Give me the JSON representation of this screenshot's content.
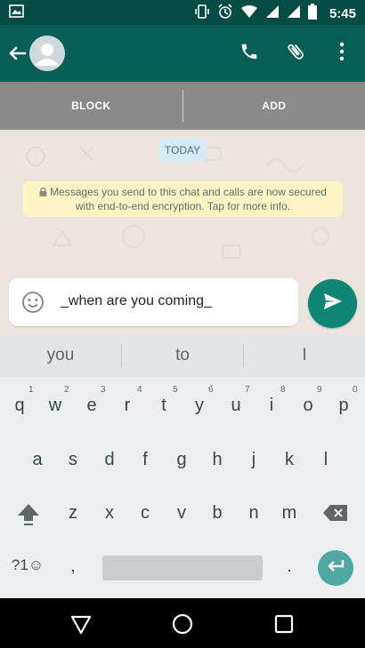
{
  "status_bar": {
    "time": "5:45"
  },
  "app_bar": {
    "icons": [
      "back-icon",
      "avatar",
      "phone-icon",
      "paperclip-icon",
      "more-vert-icon"
    ]
  },
  "actions_bar": {
    "block_label": "BLOCK",
    "add_label": "ADD"
  },
  "chat": {
    "date_chip": "TODAY",
    "encryption_notice_line1": "Messages you send to this chat and calls are now secured",
    "encryption_notice_line2": "with end-to-end encryption. Tap for more info."
  },
  "composer": {
    "text": "_when are you coming_"
  },
  "keyboard": {
    "suggestions": [
      "you",
      "to",
      "I"
    ],
    "row1": [
      {
        "k": "q",
        "n": "1"
      },
      {
        "k": "w",
        "n": "2"
      },
      {
        "k": "e",
        "n": "3"
      },
      {
        "k": "r",
        "n": "4"
      },
      {
        "k": "t",
        "n": "5"
      },
      {
        "k": "y",
        "n": "6"
      },
      {
        "k": "u",
        "n": "7"
      },
      {
        "k": "i",
        "n": "8"
      },
      {
        "k": "o",
        "n": "9"
      },
      {
        "k": "p",
        "n": "0"
      }
    ],
    "row2": [
      "a",
      "s",
      "d",
      "f",
      "g",
      "h",
      "j",
      "k",
      "l"
    ],
    "row3": [
      "z",
      "x",
      "c",
      "v",
      "b",
      "n",
      "m"
    ],
    "symbols_label": "?1☺",
    "comma": ",",
    "period": "."
  },
  "colors": {
    "primary": "#075e54",
    "accent": "#0e8676",
    "chat_bg": "#ece5dd",
    "notice_bg": "#fff4c4"
  }
}
